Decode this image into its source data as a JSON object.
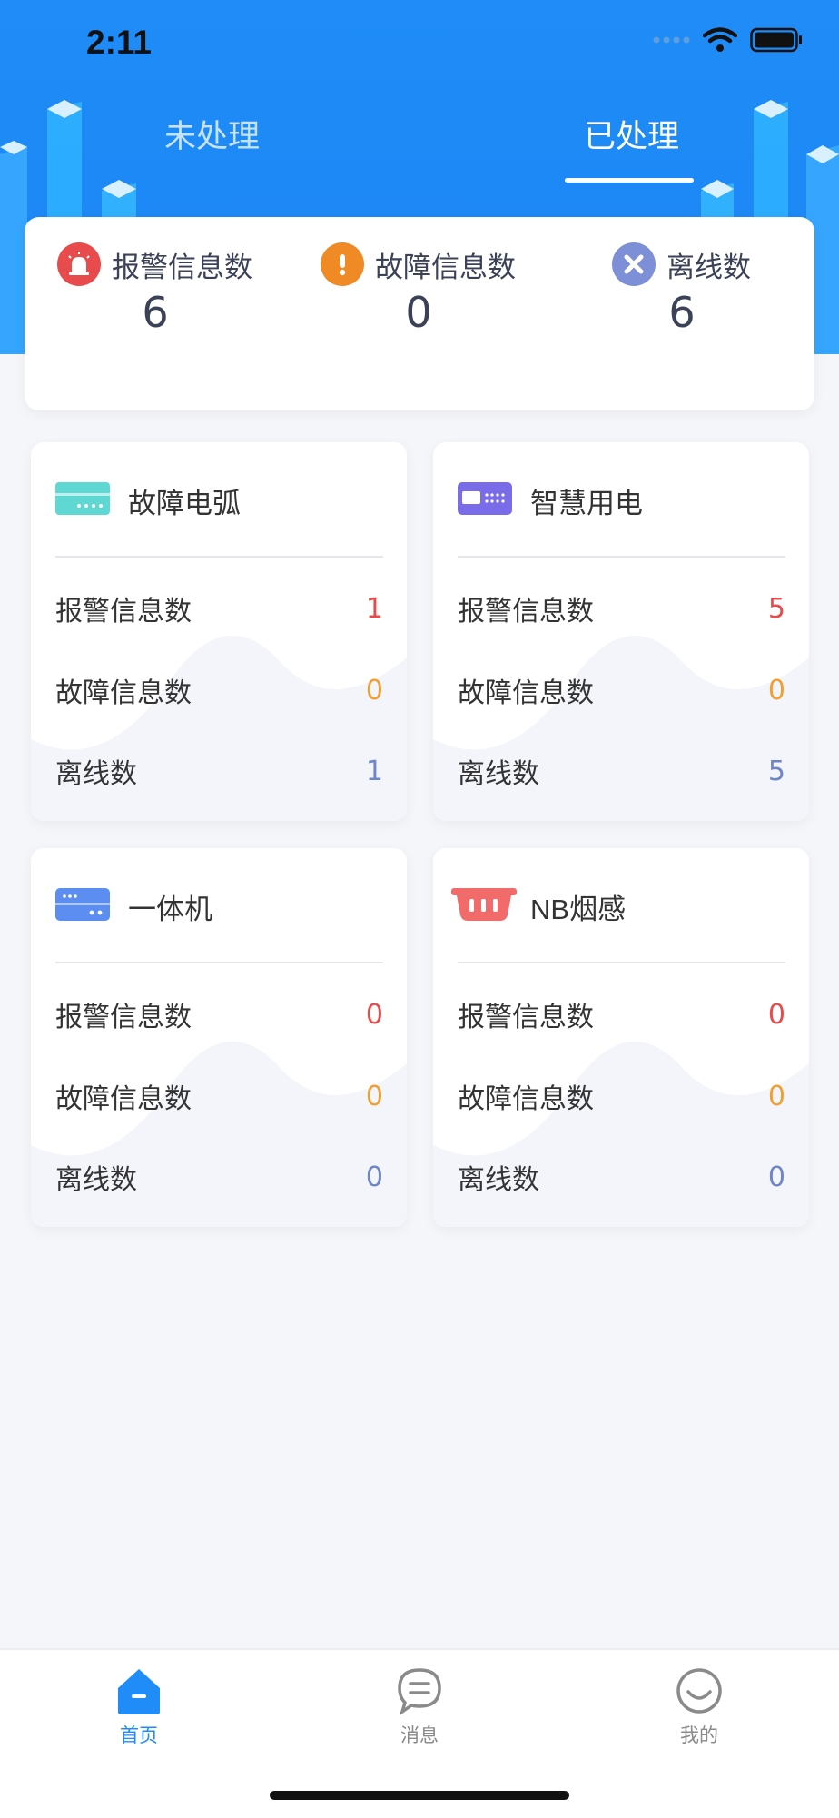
{
  "status_bar": {
    "time": "2:11"
  },
  "tabs": [
    {
      "label": "未处理",
      "active": false
    },
    {
      "label": "已处理",
      "active": true
    }
  ],
  "summary": [
    {
      "icon": "alarm-icon",
      "label": "报警信息数",
      "value": "6",
      "color": "#e84b4b"
    },
    {
      "icon": "warning-icon",
      "label": "故障信息数",
      "value": "0",
      "color": "#f08a24"
    },
    {
      "icon": "offline-icon",
      "label": "离线数",
      "value": "6",
      "color": "#7d8fd6"
    }
  ],
  "devices": [
    {
      "name": "故障电弧",
      "icon": "arc-fault-device-icon",
      "icon_color": "#5fd8d4",
      "stats": [
        {
          "label": "报警信息数",
          "value": "1"
        },
        {
          "label": "故障信息数",
          "value": "0"
        },
        {
          "label": "离线数",
          "value": "1"
        }
      ]
    },
    {
      "name": "智慧用电",
      "icon": "smart-power-device-icon",
      "icon_color": "#7a6ce8",
      "stats": [
        {
          "label": "报警信息数",
          "value": "5"
        },
        {
          "label": "故障信息数",
          "value": "0"
        },
        {
          "label": "离线数",
          "value": "5"
        }
      ]
    },
    {
      "name": "一体机",
      "icon": "all-in-one-device-icon",
      "icon_color": "#5b8ef0",
      "stats": [
        {
          "label": "报警信息数",
          "value": "0"
        },
        {
          "label": "故障信息数",
          "value": "0"
        },
        {
          "label": "离线数",
          "value": "0"
        }
      ]
    },
    {
      "name": "NB烟感",
      "icon": "nb-smoke-detector-icon",
      "icon_color": "#f26b6b",
      "stats": [
        {
          "label": "报警信息数",
          "value": "0"
        },
        {
          "label": "故障信息数",
          "value": "0"
        },
        {
          "label": "离线数",
          "value": "0"
        }
      ]
    }
  ],
  "tabbar": [
    {
      "label": "首页",
      "icon": "home-icon",
      "active": true
    },
    {
      "label": "消息",
      "icon": "message-icon",
      "active": false
    },
    {
      "label": "我的",
      "icon": "smiley-icon",
      "active": false
    }
  ],
  "colors": {
    "brand": "#1f8cf7",
    "alarm": "#e84b4b",
    "fault": "#f0a032",
    "offline": "#6e86c7"
  }
}
